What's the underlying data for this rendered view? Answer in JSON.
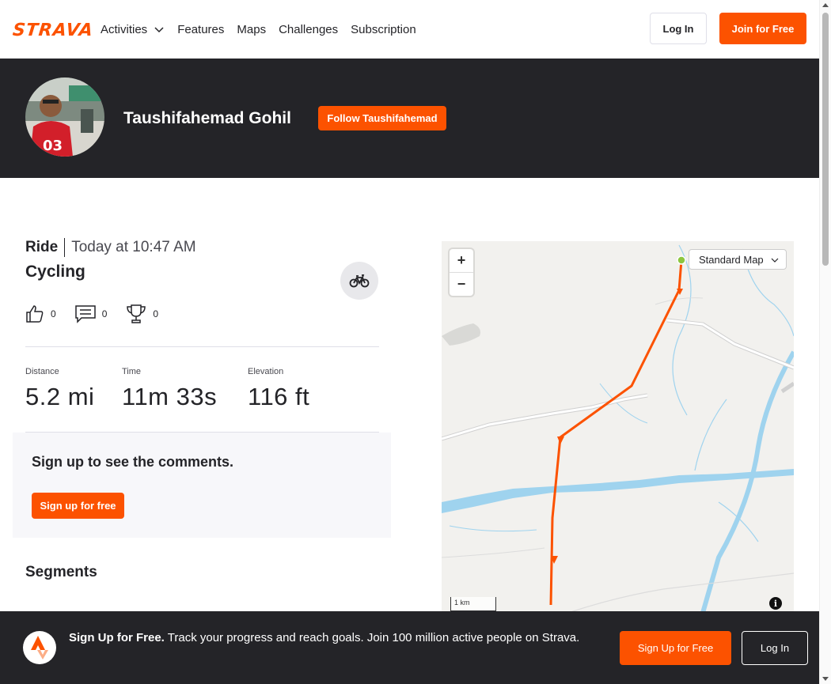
{
  "nav": {
    "logo": "STRAVA",
    "links": [
      "Activities",
      "Features",
      "Maps",
      "Challenges",
      "Subscription"
    ],
    "login_label": "Log In",
    "join_label": "Join for Free"
  },
  "athlete": {
    "name": "Taushifahemad Gohil",
    "follow_label": "Follow Taushifahemad"
  },
  "activity": {
    "type": "Ride",
    "datetime": "Today at 10:47 AM",
    "name": "Cycling",
    "kudos": "0",
    "comments": "0",
    "achievements": "0",
    "stats": [
      {
        "label": "Distance",
        "value": "5.2 mi"
      },
      {
        "label": "Time",
        "value": "11m 33s"
      },
      {
        "label": "Elevation",
        "value": "116 ft"
      }
    ]
  },
  "comments": {
    "title": "Sign up to see the comments.",
    "button_label": "Sign up for free"
  },
  "segments": {
    "title": "Segments"
  },
  "map": {
    "style_label": "Standard Map",
    "scale_label": "1 km",
    "info_label": "i",
    "route_color": "#fc5200"
  },
  "banner": {
    "headline": "Sign Up for Free.",
    "text": "Track your progress and reach goals. Join 100 million active people on Strava.",
    "signup_label": "Sign Up for Free",
    "login_label": "Log In"
  },
  "colors": {
    "brand": "#fc5200",
    "dark": "#242428"
  }
}
